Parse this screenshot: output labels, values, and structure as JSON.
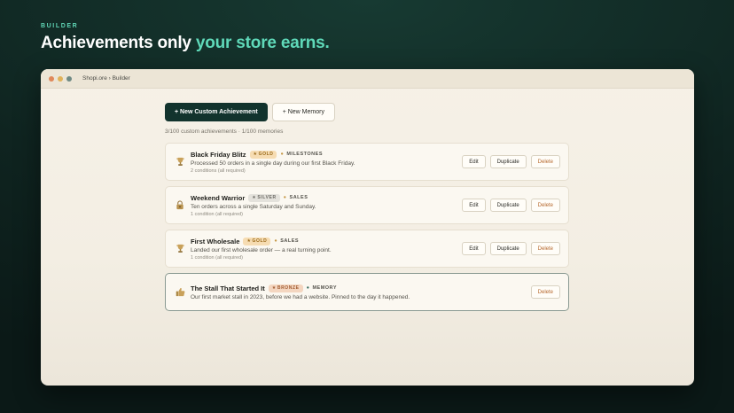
{
  "hero": {
    "eyebrow": "BUILDER",
    "headline_main": "Achievements only ",
    "headline_accent": "your store earns."
  },
  "window": {
    "breadcrumb": "Shopi.ore › Builder"
  },
  "toolbar": {
    "new_achievement_label": "+ New Custom Achievement",
    "new_memory_label": "+ New Memory"
  },
  "counts": "3/100 custom achievements · 1/100 memories",
  "labels": {
    "edit": "Edit",
    "duplicate": "Duplicate",
    "delete": "Delete"
  },
  "items": [
    {
      "icon": "trophy-icon",
      "title": "Black Friday Blitz",
      "tier": "GOLD",
      "category": "MILESTONES",
      "description": "Processed 50 orders in a single day during our first Black Friday.",
      "conditions": "2 conditions (all required)"
    },
    {
      "icon": "lock-icon",
      "title": "Weekend Warrior",
      "tier": "SILVER",
      "category": "SALES",
      "description": "Ten orders across a single Saturday and Sunday.",
      "conditions": "1 condition (all required)"
    },
    {
      "icon": "trophy-icon",
      "title": "First Wholesale",
      "tier": "GOLD",
      "category": "SALES",
      "description": "Landed our first wholesale order — a real turning point.",
      "conditions": "1 condition (all required)"
    },
    {
      "icon": "thumbs-up-icon",
      "title": "The Stall That Started It",
      "tier": "BRONZE",
      "category": "MEMORY",
      "description": "Our first market stall in 2023, before we had a website. Pinned to the day it happened."
    }
  ],
  "colors": {
    "accent": "#5fd9b9",
    "primary_button": "#12332d",
    "delete_text": "#b7692e"
  }
}
